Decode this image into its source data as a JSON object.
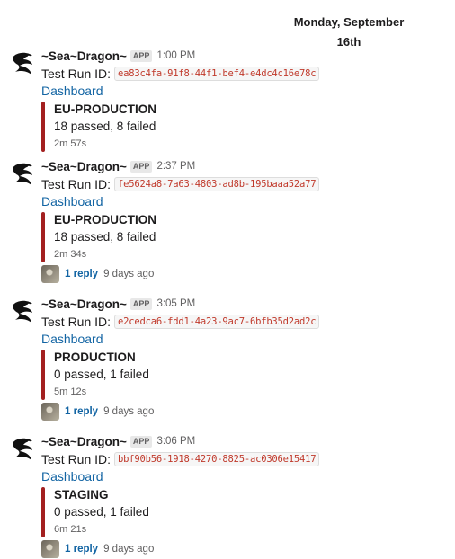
{
  "date_divider": "Monday, September 16th",
  "messages": [
    {
      "sender": "~Sea~Dragon~",
      "badge": "APP",
      "time": "1:00 PM",
      "id_label": "Test Run ID:",
      "run_id": "ea83c4fa-91f8-44f1-bef4-e4dc4c16e78c",
      "link": "Dashboard",
      "env": "EU-PRODUCTION",
      "result": "18 passed, 8 failed",
      "duration": "2m 57s",
      "accent": "#a32020"
    },
    {
      "sender": "~Sea~Dragon~",
      "badge": "APP",
      "time": "2:37 PM",
      "id_label": "Test Run ID:",
      "run_id": "fe5624a8-7a63-4803-ad8b-195baaa52a77",
      "link": "Dashboard",
      "env": "EU-PRODUCTION",
      "result": "18 passed, 8 failed",
      "duration": "2m 34s",
      "replies": "1 reply",
      "reply_age": "9 days ago",
      "accent": "#a32020"
    },
    {
      "sender": "~Sea~Dragon~",
      "badge": "APP",
      "time": "3:05 PM",
      "id_label": "Test Run ID:",
      "run_id": "e2cedca6-fdd1-4a23-9ac7-6bfb35d2ad2c",
      "link": "Dashboard",
      "env": "PRODUCTION",
      "result": "0 passed, 1 failed",
      "duration": "5m 12s",
      "replies": "1 reply",
      "reply_age": "9 days ago",
      "accent": "#a32020"
    },
    {
      "sender": "~Sea~Dragon~",
      "badge": "APP",
      "time": "3:06 PM",
      "id_label": "Test Run ID:",
      "run_id": "bbf90b56-1918-4270-8825-ac0306e15417",
      "link": "Dashboard",
      "env": "STAGING",
      "result": "0 passed, 1 failed",
      "duration": "6m 21s",
      "replies": "1 reply",
      "reply_age": "9 days ago",
      "accent": "#a32020"
    }
  ]
}
